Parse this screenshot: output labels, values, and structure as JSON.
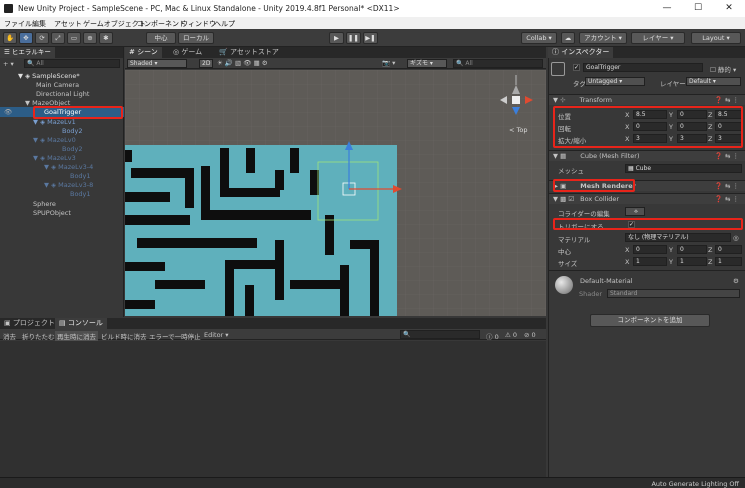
{
  "window": {
    "title": "New Unity Project - SampleScene - PC, Mac & Linux Standalone - Unity 2019.4.8f1 Personal* <DX11>",
    "minimize": "—",
    "maximize": "☐",
    "close": "✕"
  },
  "menu": [
    "ファイル",
    "編集",
    "アセット",
    "ゲームオブジェクト",
    "コンポーネント",
    "ウィンドウ",
    "ヘルプ"
  ],
  "toolbar": {
    "pivot": "中心",
    "space": "ローカル",
    "play": "▶",
    "pause": "❚❚",
    "step": "▶❚",
    "collab": "Collab ▾",
    "account": "アカウント ▾",
    "layers": "レイヤー ▾",
    "layout": "Layout ▾"
  },
  "hierarchy": {
    "tab": "ヒエラルキー",
    "search_placeholder": "All",
    "add": "+ ▾",
    "items": [
      {
        "label": "SampleScene*"
      },
      {
        "label": "Main Camera"
      },
      {
        "label": "Directional Light"
      },
      {
        "label": "MazeObject"
      },
      {
        "label": "GoalTrigger"
      },
      {
        "label": "MazeLv1"
      },
      {
        "label": "Body2"
      },
      {
        "label": "MazeLv0"
      },
      {
        "label": "Body2"
      },
      {
        "label": "MazeLv3"
      },
      {
        "label": "MazeLv3-4"
      },
      {
        "label": "Body1"
      },
      {
        "label": "MazeLv3-8"
      },
      {
        "label": "Body1"
      },
      {
        "label": "Sphere"
      },
      {
        "label": "SPUPObject"
      }
    ]
  },
  "scene": {
    "tabs": [
      "シーン",
      "ゲーム",
      "アセットストア"
    ],
    "shading": "Shaded",
    "mode2d": "2D",
    "gizmos": "ギズモ ▾",
    "search_placeholder": "All",
    "persp": "< Top"
  },
  "console": {
    "tabs": [
      "プロジェクト",
      "コンソール"
    ],
    "buttons": [
      "消去",
      "折りたたむ",
      "再生時に消去",
      "ビルド時に消去",
      "エラーで一時停止",
      "Editor ▾"
    ],
    "counts": [
      "0",
      "0",
      "0"
    ]
  },
  "inspector": {
    "tab": "インスペクター",
    "name": "GoalTrigger",
    "static": "静的 ▾",
    "tag_label": "タグ",
    "tag": "Untagged",
    "layer_label": "レイヤー",
    "layer": "Default",
    "transform": {
      "title": "Transform",
      "position_label": "位置",
      "rotation_label": "回転",
      "scale_label": "拡大/縮小",
      "position": {
        "x": "8.5",
        "y": "0",
        "z": "8.5"
      },
      "rotation": {
        "x": "0",
        "y": "0",
        "z": "0"
      },
      "scale": {
        "x": "3",
        "y": "3",
        "z": "3"
      }
    },
    "mesh_filter": {
      "title": "Cube (Mesh Filter)",
      "mesh_label": "メッシュ",
      "mesh": "Cube"
    },
    "mesh_renderer": {
      "title": "Mesh Renderer"
    },
    "box_collider": {
      "title": "Box Collider",
      "edit_label": "コライダーの編集",
      "trigger_label": "トリガーにする",
      "material_label": "マテリアル",
      "material": "なし (物理マテリアル)",
      "center_label": "中心",
      "center": {
        "x": "0",
        "y": "0",
        "z": "0"
      },
      "size_label": "サイズ",
      "size": {
        "x": "1",
        "y": "1",
        "z": "1"
      }
    },
    "material": {
      "name": "Default-Material",
      "shader_label": "Shader",
      "shader": "Standard"
    },
    "add_component": "コンポーネントを追加"
  },
  "status": {
    "text": "Auto Generate Lighting Off"
  },
  "colors": {
    "accent": "#3e7fc9",
    "highlight": "#e8241a",
    "maze": "#5fb0bc"
  }
}
